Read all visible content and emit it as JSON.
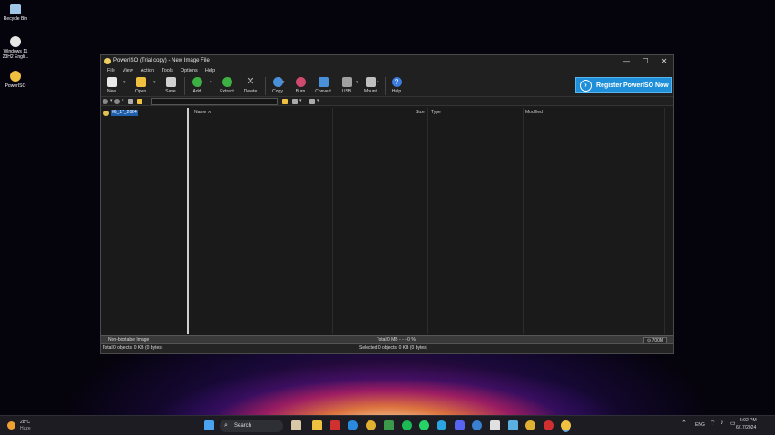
{
  "desktop": {
    "icons": [
      {
        "label": "Recycle Bin",
        "color": "#9fc6e6"
      },
      {
        "label": "Windows 11 23H2 Engli...",
        "color": "#e6e6e6"
      },
      {
        "label": "PowerISO",
        "color": "#f0c040"
      }
    ]
  },
  "window": {
    "title": "PowerISO (Trial copy) - New Image File",
    "controls": {
      "minimize": "—",
      "maximize": "☐",
      "close": "✕"
    },
    "menu": [
      "File",
      "View",
      "Action",
      "Tools",
      "Options",
      "Help"
    ],
    "toolbar": [
      {
        "label": "New",
        "color": "#e8e8e8"
      },
      {
        "label": "Open",
        "color": "#f0c040"
      },
      {
        "label": "Save",
        "color": "#d0d0d0"
      },
      {
        "label": "Add",
        "color": "#3cb043"
      },
      {
        "label": "Extract",
        "color": "#3cb043"
      },
      {
        "label": "Delete",
        "color": "#b0b0b0"
      },
      {
        "label": "Copy",
        "color": "#4a90d9"
      },
      {
        "label": "Burn",
        "color": "#d04a70"
      },
      {
        "label": "Convert",
        "color": "#4a90d9"
      },
      {
        "label": "USB",
        "color": "#a0a0a0"
      },
      {
        "label": "Mount",
        "color": "#c0c0c0"
      },
      {
        "label": "Help",
        "color": "#3c7be0"
      }
    ],
    "register_button": "Register PowerISO Now",
    "address_value": "",
    "tree": {
      "root_label": "06_17_2024"
    },
    "columns": {
      "name": "Name  ∧",
      "size": "Size",
      "type": "Type",
      "modified": "Modified"
    },
    "status": {
      "boot": "Non-bootable Image",
      "total": "Total  0 MB   - - -  0 %",
      "capacity": "⊙ 700M",
      "objects": "Total 0 objects, 0 KB (0 bytes)",
      "selected": "Selected 0 objects, 0 KB (0 bytes)"
    }
  },
  "taskbar": {
    "weather_temp": "28°C",
    "weather_desc": "Haze",
    "search_placeholder": "Search",
    "lang": "ENG",
    "time": "5:02 PM",
    "date": "6/17/2024"
  }
}
